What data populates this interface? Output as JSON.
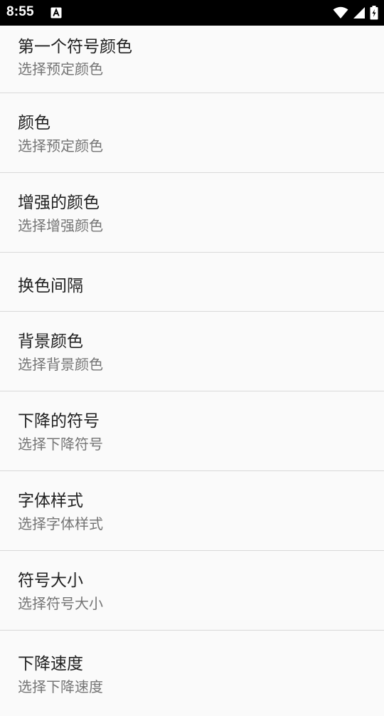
{
  "status_bar": {
    "time": "8:55",
    "icons": [
      "accessibility-notification-icon",
      "wifi-icon",
      "cell-signal-icon",
      "battery-charging-icon"
    ]
  },
  "preferences": [
    {
      "title": "第一个符号颜色",
      "summary": "选择预定颜色"
    },
    {
      "title": "颜色",
      "summary": "选择预定颜色"
    },
    {
      "title": "增强的颜色",
      "summary": "选择增强颜色"
    },
    {
      "title": "换色间隔",
      "summary": ""
    },
    {
      "title": "背景颜色",
      "summary": "选择背景颜色"
    },
    {
      "title": "下降的符号",
      "summary": "选择下降符号"
    },
    {
      "title": "字体样式",
      "summary": "选择字体样式"
    },
    {
      "title": "符号大小",
      "summary": "选择符号大小"
    },
    {
      "title": "下降速度",
      "summary": "选择下降速度"
    }
  ]
}
